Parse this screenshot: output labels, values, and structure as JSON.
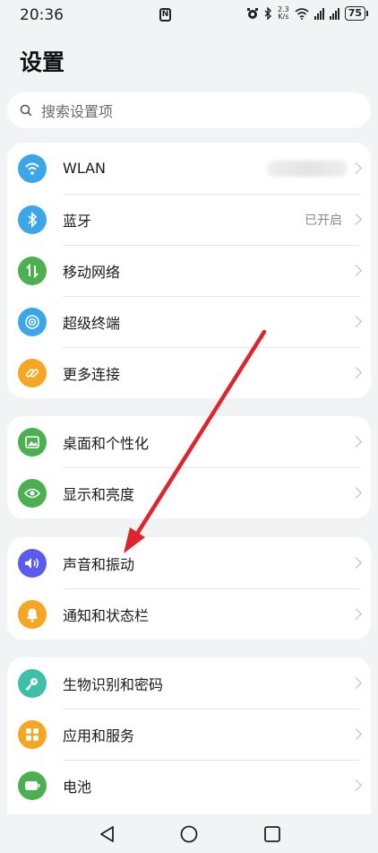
{
  "status_bar": {
    "time": "20:36",
    "nfc_glyph": "N",
    "net_speed_value": "2.3",
    "net_speed_unit": "K/s",
    "battery": "75"
  },
  "page": {
    "title": "设置"
  },
  "search": {
    "placeholder": "搜索设置项"
  },
  "groups": [
    {
      "items": [
        {
          "label": "WLAN",
          "icon": "wifi-icon",
          "color": "#3ba7e8"
        },
        {
          "label": "蓝牙",
          "value": "已开启",
          "icon": "bluetooth-icon",
          "color": "#3ba7e8"
        },
        {
          "label": "移动网络",
          "icon": "mobile-data-icon",
          "color": "#4caf50"
        },
        {
          "label": "超级终端",
          "icon": "super-device-icon",
          "color": "#3ba7e8"
        },
        {
          "label": "更多连接",
          "icon": "link-icon",
          "color": "#f5a623"
        }
      ]
    },
    {
      "items": [
        {
          "label": "桌面和个性化",
          "icon": "wallpaper-icon",
          "color": "#4caf50"
        },
        {
          "label": "显示和亮度",
          "icon": "eye-icon",
          "color": "#4caf50"
        }
      ]
    },
    {
      "items": [
        {
          "label": "声音和振动",
          "icon": "speaker-icon",
          "color": "#5b5bf0"
        },
        {
          "label": "通知和状态栏",
          "icon": "bell-icon",
          "color": "#f5a623"
        }
      ]
    },
    {
      "items": [
        {
          "label": "生物识别和密码",
          "icon": "key-icon",
          "color": "#3dbfa8"
        },
        {
          "label": "应用和服务",
          "icon": "apps-icon",
          "color": "#f5a623"
        },
        {
          "label": "电池",
          "icon": "battery-icon",
          "color": "#4caf50"
        }
      ]
    }
  ],
  "annotation": {
    "arrow_color": "#e0242b"
  },
  "nav": {
    "back": "back-icon",
    "home": "home-icon",
    "recents": "recents-icon"
  }
}
